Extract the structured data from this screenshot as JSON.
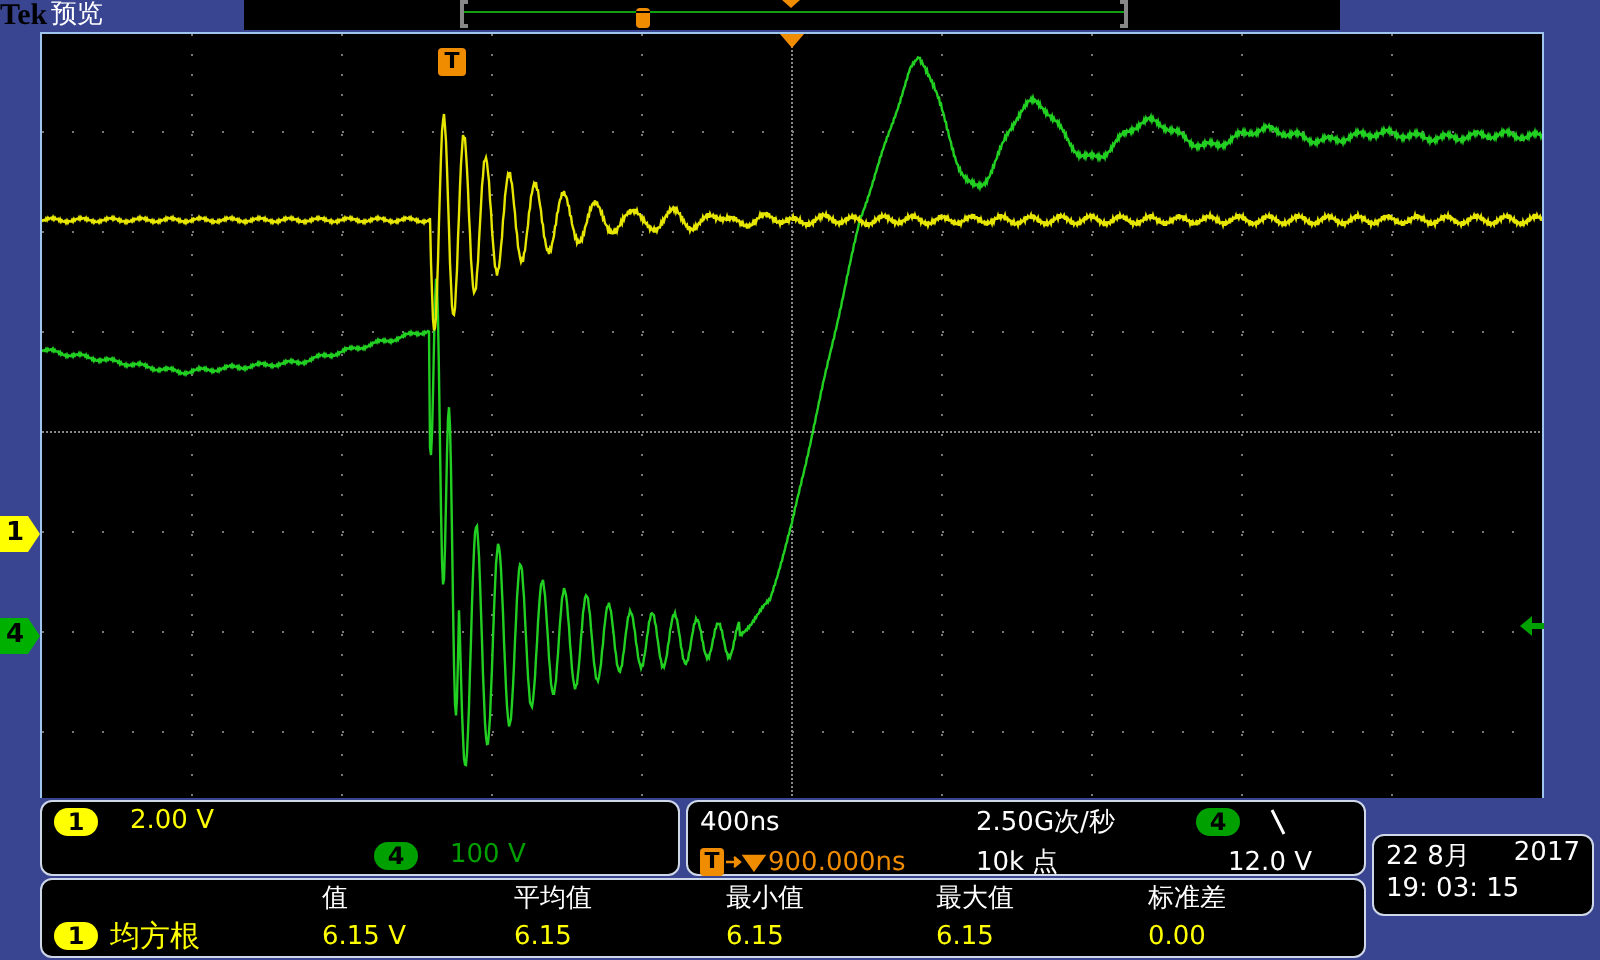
{
  "header": {
    "brand": "Tek",
    "mode": "预览"
  },
  "trigger_marker": {
    "label": "T"
  },
  "channel_markers": [
    {
      "label": "1",
      "color": "#ffff00"
    },
    {
      "label": "4",
      "color": "#00b000"
    }
  ],
  "vertical": [
    {
      "channel": "1",
      "color": "#ffff00",
      "scale": "2.00 V"
    },
    {
      "channel": "4",
      "color": "#00a000",
      "scale": "100 V"
    }
  ],
  "horizontal": {
    "scale": "400ns",
    "sample_rate": "2.50G次/秒",
    "trigger_label": "T",
    "delay": "900.000ns",
    "record_length": "10k 点"
  },
  "trigger": {
    "channel": "4",
    "color": "#00a000",
    "falling_edge": true,
    "level": "12.0 V"
  },
  "measurements": {
    "columns": [
      "值",
      "平均值",
      "最小值",
      "最大值",
      "标准差"
    ],
    "rows": [
      {
        "channel": "1",
        "color": "#ffff00",
        "type": "均方根",
        "values": [
          "6.15 V",
          "6.15",
          "6.15",
          "6.15",
          "0.00"
        ]
      }
    ]
  },
  "clock": {
    "date": "22 8月",
    "year": "2017",
    "time": "19: 03: 15"
  }
}
